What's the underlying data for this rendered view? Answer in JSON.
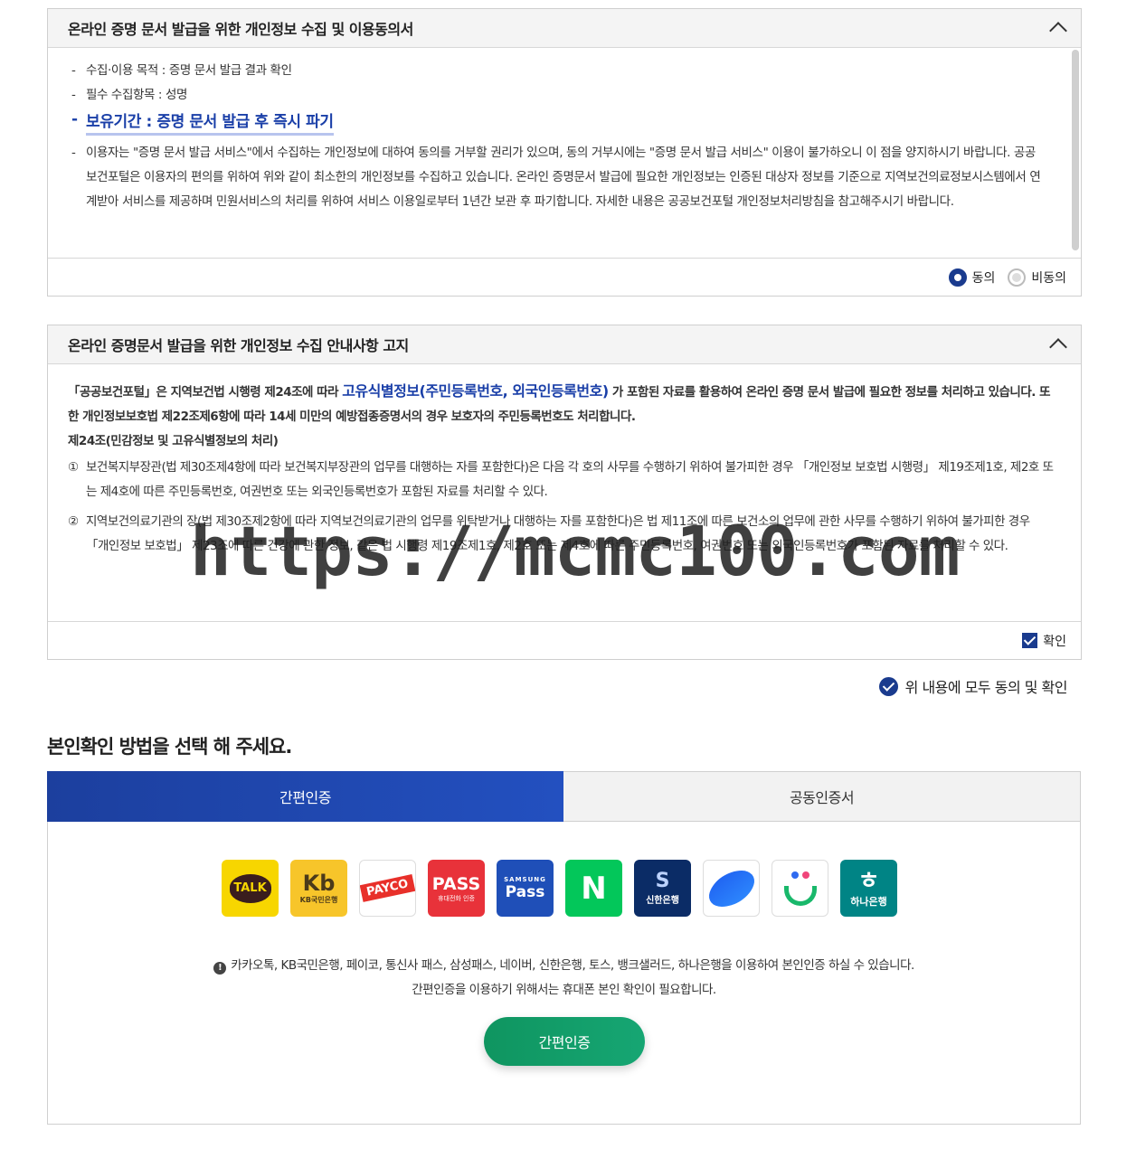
{
  "consent_panel": {
    "title": "온라인 증명 문서 발급을 위한 개인정보 수집 및 이용동의서",
    "items": [
      "수집·이용 목적 : 증명 문서 발급 결과 확인",
      "필수 수집항목 : 성명",
      "보유기간 : 증명 문서 발급 후 즉시 파기",
      "이용자는 \"증명 문서 발급 서비스\"에서 수집하는 개인정보에 대하여 동의를 거부할 권리가 있으며, 동의 거부시에는 \"증명 문서 발급 서비스\" 이용이 불가하오니 이 점을 양지하시기 바랍니다. 공공보건포털은 이용자의 편의를 위하여 위와 같이 최소한의 개인정보를 수집하고 있습니다. 온라인 증명문서 발급에 필요한 개인정보는 인증된 대상자 정보를 기준으로 지역보건의료정보시스템에서 연계받아 서비스를 제공하며 민원서비스의 처리를 위하여 서비스 이용일로부터 1년간 보관 후 파기합니다. 자세한 내용은 공공보건포털 개인정보처리방침을 참고해주시기 바랍니다."
    ],
    "agree_label": "동의",
    "disagree_label": "비동의"
  },
  "notice_panel": {
    "title": "온라인 증명문서 발급을 위한 개인정보 수집 안내사항 고지",
    "p1_a": "「공공보건포털」은 지역보건법 시행령 제24조에 따라 ",
    "p1_b": "고유식별정보(주민등록번호, 외국인등록번호)",
    "p1_c": " 가 포함된 자료를 활용하여 온라인 증명 문서 발급에 필요한 정보를 처리하고 있습니다. 또한 개인정보보호법 제22조제6항에 따라 14세 미만의 예방접종증명서의 경우 보호자의 주민등록번호도 처리합니다.",
    "article_title": "제24조(민감정보 및 고유식별정보의 처리)",
    "clauses": [
      {
        "num": "①",
        "text": "보건복지부장관(법 제30조제4항에 따라 보건복지부장관의 업무를 대행하는 자를 포함한다)은 다음 각 호의 사무를 수행하기 위하여 불가피한 경우 「개인정보 보호법 시행령」 제19조제1호, 제2호 또는 제4호에 따른 주민등록번호, 여권번호 또는 외국인등록번호가 포함된 자료를 처리할 수 있다."
      },
      {
        "num": "②",
        "text": "지역보건의료기관의 장(법 제30조제2항에 따라 지역보건의료기관의 업무를 위탁받거나 대행하는 자를 포함한다)은 법 제11조에 따른 보건소의 업무에 관한 사무를 수행하기 위하여 불가피한 경우 「개인정보 보호법」 제23조에 따른 건강에 관한 정보, 같은 법 시행령 제19조제1호, 제2호 또는 제4호에 따른 주민등록번호, 여권번호 또는 외국인등록번호가 포함된 자료를 처리할 수 있다."
      }
    ],
    "confirm_label": "확인"
  },
  "agree_all_label": "위 내용에 모두 동의 및 확인",
  "section_title": "본인확인 방법을 선택 해 주세요.",
  "tabs": [
    "간편인증",
    "공동인증서"
  ],
  "providers": {
    "kakao": "TALK",
    "kb_mark": "Kb",
    "kb_name": "KB국민은행",
    "payco": "PAYCO",
    "pass": "PASS",
    "pass_sub": "휴대전화 인증",
    "samsung_top": "SAMSUNG",
    "samsung_main": "Pass",
    "naver": "N",
    "shinhan_mark": "S",
    "shinhan_name": "신한은행",
    "hana_mark": "ㅎ",
    "hana_name": "하나은행"
  },
  "provider_icons": [
    "kakao-icon",
    "kb-icon",
    "payco-icon",
    "pass-icon",
    "samsung-pass-icon",
    "naver-icon",
    "shinhan-icon",
    "toss-icon",
    "banksalad-icon",
    "hana-icon"
  ],
  "note_line1": "카카오톡, KB국민은행, 페이코, 통신사 패스, 삼성패스, 네이버, 신한은행, 토스, 뱅크샐러드, 하나은행을 이용하여 본인인증 하실 수 있습니다.",
  "note_line2": "간편인증을 이용하기 위해서는 휴대폰 본인 확인이 필요합니다.",
  "info_glyph": "!",
  "submit_label": "간편인증",
  "watermark": "https://mcmc100.com",
  "colors": {
    "primary": "#1a3b8e",
    "tab_active": "#1c3f9e",
    "button": "#0f9560"
  }
}
